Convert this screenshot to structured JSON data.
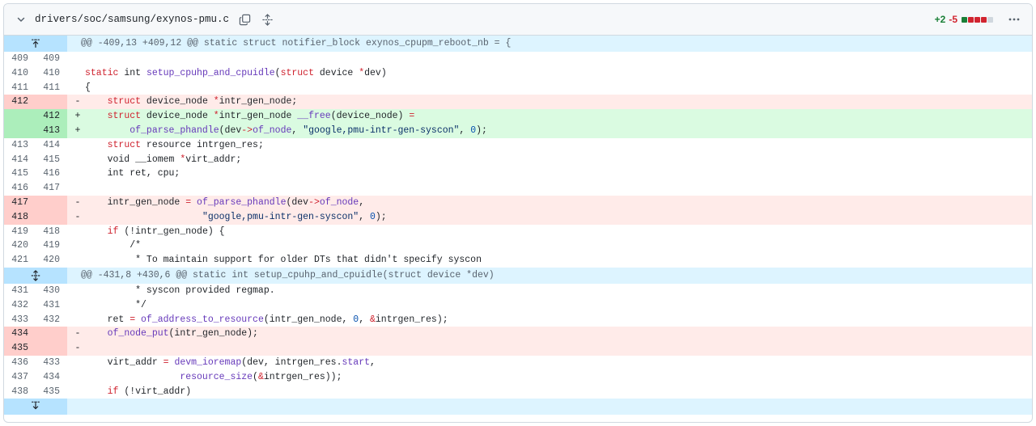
{
  "file_header": {
    "path": "drivers/soc/samsung/exynos-pmu.c",
    "additions": "+2",
    "deletions": "-5",
    "diffstat_colors": [
      "#1a7f37",
      "#d1242f",
      "#d1242f",
      "#d1242f",
      "#d0d7de"
    ]
  },
  "rows": [
    {
      "type": "hunk",
      "text": "@@ -409,13 +409,12 @@ static struct notifier_block exynos_cpupm_reboot_nb = {",
      "expander": "expand-up"
    },
    {
      "type": "ctx",
      "old": "409",
      "new": "409",
      "sign": "",
      "tokens": []
    },
    {
      "type": "ctx",
      "old": "410",
      "new": "410",
      "sign": "",
      "tokens": [
        [
          "kw",
          "static"
        ],
        [
          "pl",
          " int "
        ],
        [
          "fn",
          "setup_cpuhp_and_cpuidle"
        ],
        [
          "pl",
          "("
        ],
        [
          "kw",
          "struct"
        ],
        [
          "pl",
          " device "
        ],
        [
          "kw",
          "*"
        ],
        [
          "pl",
          "dev)"
        ]
      ]
    },
    {
      "type": "ctx",
      "old": "411",
      "new": "411",
      "sign": "",
      "tokens": [
        [
          "pl",
          "{"
        ]
      ]
    },
    {
      "type": "del",
      "old": "412",
      "new": "",
      "sign": "-",
      "tokens": [
        [
          "pl",
          "    "
        ],
        [
          "kw",
          "struct"
        ],
        [
          "pl",
          " device_node "
        ],
        [
          "kw",
          "*"
        ],
        [
          "pl",
          "intr_gen_node;"
        ]
      ]
    },
    {
      "type": "add",
      "old": "",
      "new": "412",
      "sign": "+",
      "tokens": [
        [
          "pl",
          "    "
        ],
        [
          "kw",
          "struct"
        ],
        [
          "pl",
          " device_node "
        ],
        [
          "kw",
          "*"
        ],
        [
          "pl",
          "intr_gen_node "
        ],
        [
          "fn",
          "__free"
        ],
        [
          "pl",
          "(device_node) "
        ],
        [
          "kw",
          "="
        ]
      ]
    },
    {
      "type": "add",
      "old": "",
      "new": "413",
      "sign": "+",
      "tokens": [
        [
          "pl",
          "        "
        ],
        [
          "fn",
          "of_parse_phandle"
        ],
        [
          "pl",
          "(dev"
        ],
        [
          "kw",
          "->"
        ],
        [
          "fn",
          "of_node"
        ],
        [
          "pl",
          ", "
        ],
        [
          "str",
          "\"google,pmu-intr-gen-syscon\""
        ],
        [
          "pl",
          ", "
        ],
        [
          "num",
          "0"
        ],
        [
          "pl",
          ");"
        ]
      ]
    },
    {
      "type": "ctx",
      "old": "413",
      "new": "414",
      "sign": "",
      "tokens": [
        [
          "pl",
          "    "
        ],
        [
          "kw",
          "struct"
        ],
        [
          "pl",
          " resource intrgen_res;"
        ]
      ]
    },
    {
      "type": "ctx",
      "old": "414",
      "new": "415",
      "sign": "",
      "tokens": [
        [
          "pl",
          "    void __iomem "
        ],
        [
          "kw",
          "*"
        ],
        [
          "pl",
          "virt_addr;"
        ]
      ]
    },
    {
      "type": "ctx",
      "old": "415",
      "new": "416",
      "sign": "",
      "tokens": [
        [
          "pl",
          "    int ret, cpu;"
        ]
      ]
    },
    {
      "type": "ctx",
      "old": "416",
      "new": "417",
      "sign": "",
      "tokens": []
    },
    {
      "type": "del",
      "old": "417",
      "new": "",
      "sign": "-",
      "tokens": [
        [
          "pl",
          "    intr_gen_node "
        ],
        [
          "kw",
          "="
        ],
        [
          "pl",
          " "
        ],
        [
          "fn",
          "of_parse_phandle"
        ],
        [
          "pl",
          "(dev"
        ],
        [
          "kw",
          "->"
        ],
        [
          "fn",
          "of_node"
        ],
        [
          "pl",
          ","
        ]
      ]
    },
    {
      "type": "del",
      "old": "418",
      "new": "",
      "sign": "-",
      "tokens": [
        [
          "pl",
          "                     "
        ],
        [
          "str",
          "\"google,pmu-intr-gen-syscon\""
        ],
        [
          "pl",
          ", "
        ],
        [
          "num",
          "0"
        ],
        [
          "pl",
          ");"
        ]
      ]
    },
    {
      "type": "ctx",
      "old": "419",
      "new": "418",
      "sign": "",
      "tokens": [
        [
          "pl",
          "    "
        ],
        [
          "kw",
          "if"
        ],
        [
          "pl",
          " (!intr_gen_node) {"
        ]
      ]
    },
    {
      "type": "ctx",
      "old": "420",
      "new": "419",
      "sign": "",
      "tokens": [
        [
          "pl",
          "        /*"
        ]
      ]
    },
    {
      "type": "ctx",
      "old": "421",
      "new": "420",
      "sign": "",
      "tokens": [
        [
          "pl",
          "         * To maintain support for older DTs that didn't specify syscon"
        ]
      ]
    },
    {
      "type": "hunk",
      "text": "@@ -431,8 +430,6 @@ static int setup_cpuhp_and_cpuidle(struct device *dev)",
      "expander": "expand-both"
    },
    {
      "type": "ctx",
      "old": "431",
      "new": "430",
      "sign": "",
      "tokens": [
        [
          "pl",
          "         * syscon provided regmap."
        ]
      ]
    },
    {
      "type": "ctx",
      "old": "432",
      "new": "431",
      "sign": "",
      "tokens": [
        [
          "pl",
          "         */"
        ]
      ]
    },
    {
      "type": "ctx",
      "old": "433",
      "new": "432",
      "sign": "",
      "tokens": [
        [
          "pl",
          "    ret "
        ],
        [
          "kw",
          "="
        ],
        [
          "pl",
          " "
        ],
        [
          "fn",
          "of_address_to_resource"
        ],
        [
          "pl",
          "(intr_gen_node, "
        ],
        [
          "num",
          "0"
        ],
        [
          "pl",
          ", "
        ],
        [
          "kw",
          "&"
        ],
        [
          "pl",
          "intrgen_res);"
        ]
      ]
    },
    {
      "type": "del",
      "old": "434",
      "new": "",
      "sign": "-",
      "tokens": [
        [
          "pl",
          "    "
        ],
        [
          "fn",
          "of_node_put"
        ],
        [
          "pl",
          "(intr_gen_node);"
        ]
      ]
    },
    {
      "type": "del",
      "old": "435",
      "new": "",
      "sign": "-",
      "tokens": []
    },
    {
      "type": "ctx",
      "old": "436",
      "new": "433",
      "sign": "",
      "tokens": [
        [
          "pl",
          "    virt_addr "
        ],
        [
          "kw",
          "="
        ],
        [
          "pl",
          " "
        ],
        [
          "fn",
          "devm_ioremap"
        ],
        [
          "pl",
          "(dev, intrgen_res."
        ],
        [
          "fn",
          "start"
        ],
        [
          "pl",
          ","
        ]
      ]
    },
    {
      "type": "ctx",
      "old": "437",
      "new": "434",
      "sign": "",
      "tokens": [
        [
          "pl",
          "                 "
        ],
        [
          "fn",
          "resource_size"
        ],
        [
          "pl",
          "("
        ],
        [
          "kw",
          "&"
        ],
        [
          "pl",
          "intrgen_res));"
        ]
      ]
    },
    {
      "type": "ctx",
      "old": "438",
      "new": "435",
      "sign": "",
      "tokens": [
        [
          "pl",
          "    "
        ],
        [
          "kw",
          "if"
        ],
        [
          "pl",
          " (!virt_addr)"
        ]
      ]
    },
    {
      "type": "hunk",
      "text": "",
      "expander": "expand-down"
    }
  ]
}
